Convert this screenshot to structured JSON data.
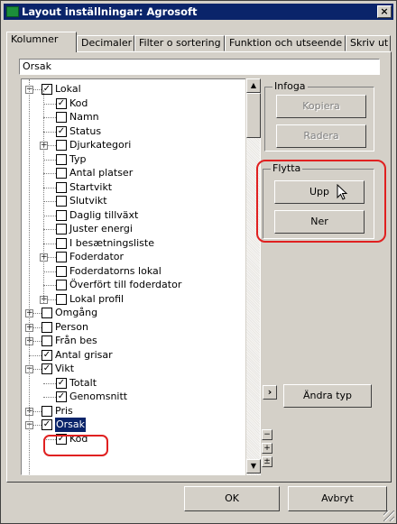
{
  "window": {
    "title": "Layout inställningar: Agrosoft",
    "close_label": "×"
  },
  "tabs": [
    "Kolumner",
    "Decimaler",
    "Filter o sortering",
    "Funktion och utseende",
    "Skriv ut"
  ],
  "field_value": "Orsak",
  "tree": [
    {
      "label": "Lokal",
      "checked": true,
      "expander": "−",
      "level": 0
    },
    {
      "label": "Kod",
      "checked": true,
      "level": 1
    },
    {
      "label": "Namn",
      "checked": false,
      "level": 1
    },
    {
      "label": "Status",
      "checked": true,
      "level": 1
    },
    {
      "label": "Djurkategori",
      "checked": false,
      "expander": "+",
      "level": 1
    },
    {
      "label": "Typ",
      "checked": false,
      "level": 1
    },
    {
      "label": "Antal platser",
      "checked": false,
      "level": 1
    },
    {
      "label": "Startvikt",
      "checked": false,
      "level": 1
    },
    {
      "label": "Slutvikt",
      "checked": false,
      "level": 1
    },
    {
      "label": "Daglig tillväxt",
      "checked": false,
      "level": 1
    },
    {
      "label": "Juster energi",
      "checked": false,
      "level": 1
    },
    {
      "label": "I besætningsliste",
      "checked": false,
      "level": 1
    },
    {
      "label": "Foderdator",
      "checked": false,
      "expander": "+",
      "level": 1
    },
    {
      "label": "Foderdatorns lokal",
      "checked": false,
      "level": 1
    },
    {
      "label": "Överfört till foderdator",
      "checked": false,
      "level": 1
    },
    {
      "label": "Lokal profil",
      "checked": false,
      "expander": "+",
      "level": 1
    },
    {
      "label": "Omgång",
      "checked": false,
      "expander": "+",
      "level": 0
    },
    {
      "label": "Person",
      "checked": false,
      "expander": "+",
      "level": 0
    },
    {
      "label": "Från bes",
      "checked": false,
      "expander": "+",
      "level": 0
    },
    {
      "label": "Antal grisar",
      "checked": true,
      "level": 0
    },
    {
      "label": "Vikt",
      "checked": true,
      "expander": "−",
      "level": 0
    },
    {
      "label": "Totalt",
      "checked": true,
      "level": 1
    },
    {
      "label": "Genomsnitt",
      "checked": true,
      "level": 1
    },
    {
      "label": "Pris",
      "checked": false,
      "expander": "+",
      "level": 0
    },
    {
      "label": "Orsak",
      "checked": true,
      "expander": "−",
      "level": 0,
      "selected": true
    },
    {
      "label": "Kod",
      "checked": true,
      "level": 1
    }
  ],
  "infoga": {
    "title": "Infoga",
    "kopiera": "Kopiera",
    "radera": "Radera"
  },
  "flytta": {
    "title": "Flytta",
    "upp": "Upp",
    "ner": "Ner"
  },
  "andra_typ": "Ändra typ",
  "arrow_button": "›",
  "footer": {
    "ok": "OK",
    "avbryt": "Avbryt"
  },
  "colors": {
    "titlebar": "#0a246a",
    "selection": "#0a246a",
    "highlight": "#e02020"
  }
}
